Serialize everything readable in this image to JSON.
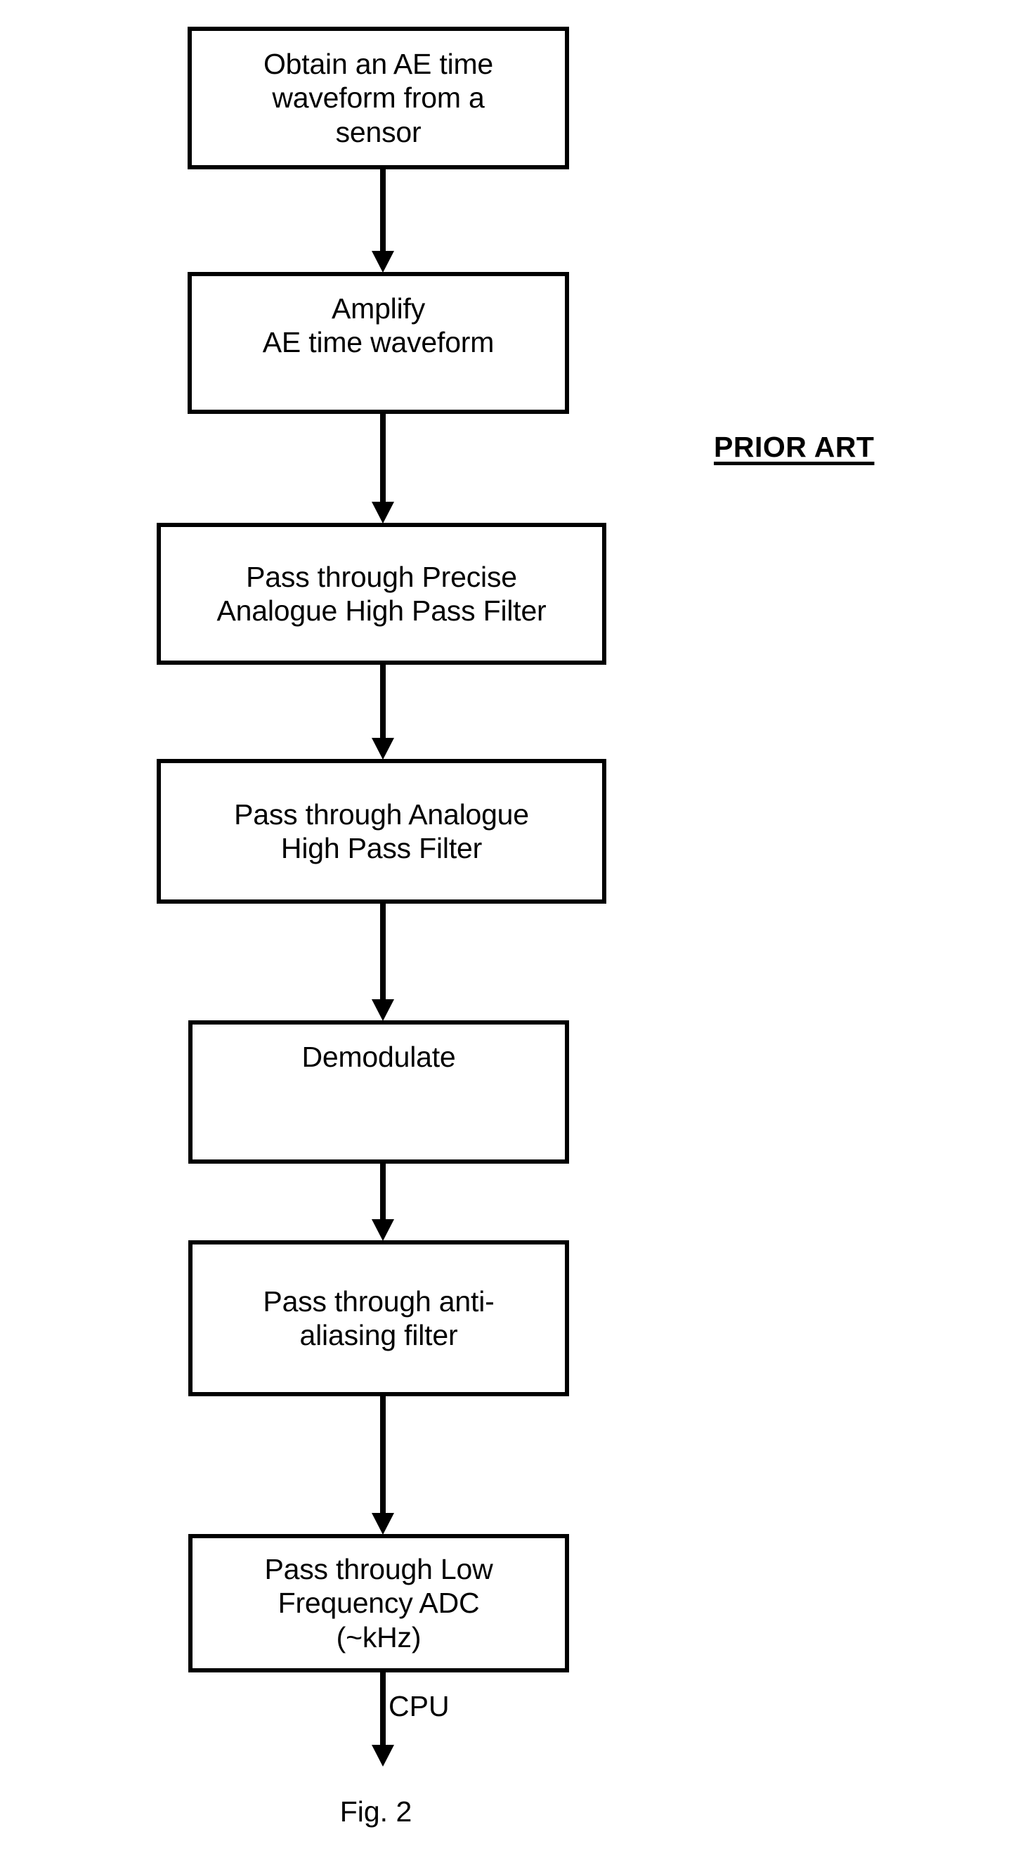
{
  "figure": {
    "caption": "Fig. 2",
    "prior_art_label": "PRIOR ART",
    "cpu_label": "CPU"
  },
  "diagram": {
    "type": "flowchart",
    "orientation": "vertical",
    "nodes": [
      {
        "id": "node-obtain-waveform",
        "label": "Obtain an AE time\nwaveform from a\nsensor",
        "lines": [
          "Obtain an AE time",
          "waveform from a",
          "sensor"
        ]
      },
      {
        "id": "node-amplify",
        "label": "Amplify\nAE time waveform",
        "lines": [
          "Amplify",
          "AE time waveform"
        ]
      },
      {
        "id": "node-precise-analogue-hpf",
        "label": "Pass through Precise\nAnalogue High Pass Filter",
        "lines": [
          "Pass through Precise",
          "Analogue High Pass Filter"
        ]
      },
      {
        "id": "node-analogue-hpf",
        "label": "Pass through Analogue\nHigh Pass Filter",
        "lines": [
          "Pass through Analogue",
          "High Pass Filter"
        ]
      },
      {
        "id": "node-demodulate",
        "label": "Demodulate",
        "lines": [
          "Demodulate"
        ]
      },
      {
        "id": "node-anti-aliasing-filter",
        "label": "Pass through anti-\naliasing filter",
        "lines": [
          "Pass through anti-",
          "aliasing filter"
        ]
      },
      {
        "id": "node-low-frequency-adc",
        "label": "Pass through Low\nFrequency ADC\n(~kHz)",
        "lines": [
          "Pass through Low",
          "Frequency ADC",
          "(~kHz)"
        ]
      }
    ],
    "edges": [
      {
        "from": "node-obtain-waveform",
        "to": "node-amplify",
        "label": ""
      },
      {
        "from": "node-amplify",
        "to": "node-precise-analogue-hpf",
        "label": ""
      },
      {
        "from": "node-precise-analogue-hpf",
        "to": "node-analogue-hpf",
        "label": ""
      },
      {
        "from": "node-analogue-hpf",
        "to": "node-demodulate",
        "label": ""
      },
      {
        "from": "node-demodulate",
        "to": "node-anti-aliasing-filter",
        "label": ""
      },
      {
        "from": "node-anti-aliasing-filter",
        "to": "node-low-frequency-adc",
        "label": ""
      },
      {
        "from": "node-low-frequency-adc",
        "to": "cpu",
        "label": "CPU"
      }
    ],
    "colors": {
      "stroke": "#000000",
      "fill": "#ffffff",
      "text": "#000000"
    }
  }
}
